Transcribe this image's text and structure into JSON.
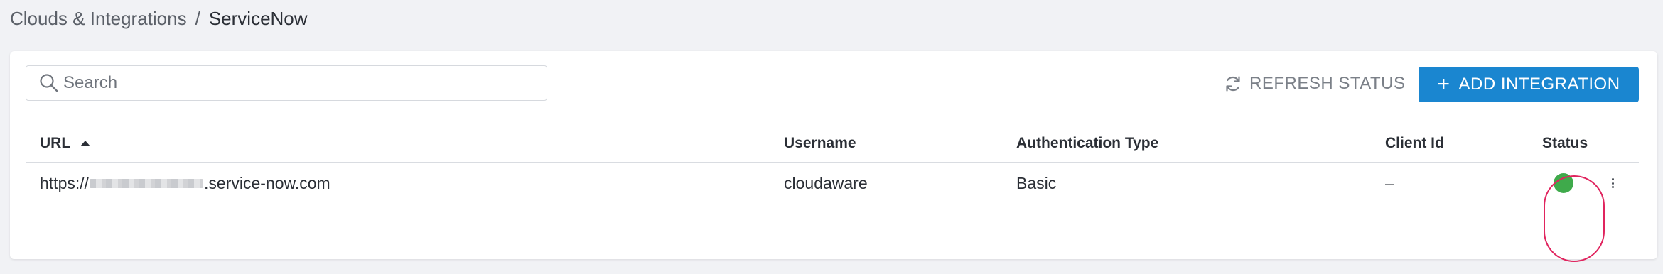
{
  "breadcrumb": {
    "parent": "Clouds & Integrations",
    "separator": "/",
    "current": "ServiceNow"
  },
  "toolbar": {
    "search_placeholder": "Search",
    "search_value": "",
    "refresh_label": "REFRESH STATUS",
    "add_label": "ADD INTEGRATION",
    "add_icon": "+"
  },
  "table": {
    "columns": {
      "url": "URL",
      "username": "Username",
      "auth_type": "Authentication Type",
      "client_id": "Client Id",
      "status": "Status"
    },
    "sort": {
      "column": "URL",
      "direction": "ascending"
    },
    "rows": [
      {
        "url_prefix": "https://",
        "url_suffix": ".service-now.com",
        "username": "cloudaware",
        "auth_type": "Basic",
        "client_id": "–",
        "status": "ok"
      }
    ]
  },
  "colors": {
    "accent": "#1a86d0",
    "status_ok": "#3faa4b",
    "highlight": "#e0245e",
    "background": "#f1f2f5"
  },
  "icons": {
    "search": "search-icon",
    "refresh": "refresh-icon",
    "sort": "sort-ascending-icon",
    "row_menu": "more-vertical-icon"
  }
}
